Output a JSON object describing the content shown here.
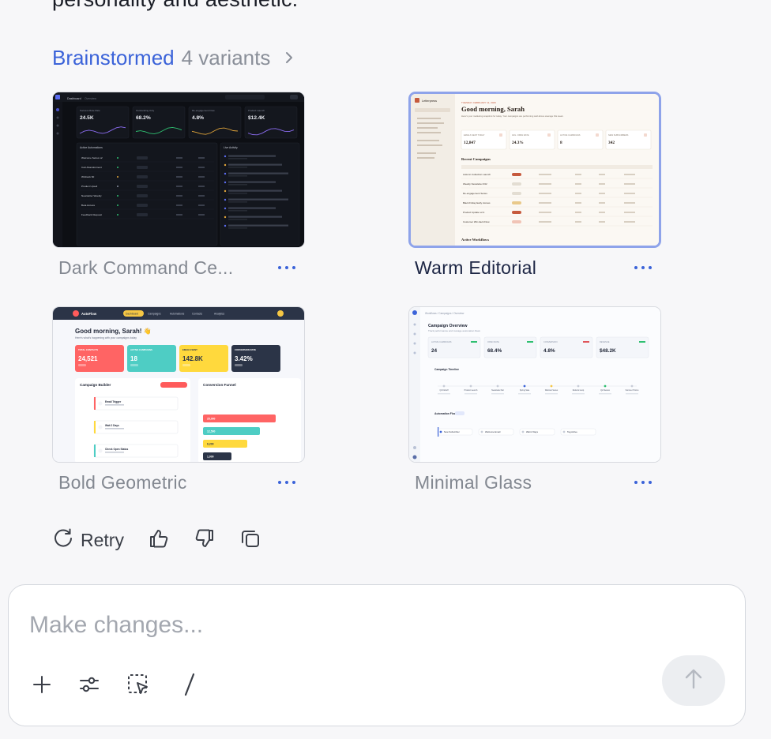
{
  "intro": {
    "text": "personality and aesthetic."
  },
  "brainstorm": {
    "label": "Brainstormed",
    "count": "4 variants",
    "chevron_icon": "chevron-right-icon"
  },
  "variants": [
    {
      "title": "Dark Command Ce...",
      "selected": false,
      "preview": {
        "nav_title": "Dashboard",
        "nav_tab": "Overview",
        "search": "Search",
        "stats": [
          {
            "label": "Success Rate Rate",
            "value": "24.5K"
          },
          {
            "label": "Outstanding Only",
            "value": "68.2%"
          },
          {
            "label": "Re-engagement Flow",
            "value": "4.8%"
          },
          {
            "label": "Product Launch",
            "value": "$12.4K"
          }
        ],
        "panel_left_title": "Active Automations",
        "panel_right_title": "Live Activity",
        "rows": [
          "Welcome Series v2",
          "Cart Abandonment",
          "Winback 60",
          "Product Upsell",
          "Newsletter Weekly",
          "Beta Access",
          "Feedback Request"
        ]
      }
    },
    {
      "title": "Warm Editorial",
      "selected": true,
      "preview": {
        "brand": "Letterpress",
        "date": "TUESDAY, FEBRUARY 11, 2026",
        "greeting": "Good morning, Sarah",
        "sub": "Here's your marketing snapshot for today. Your campaigns are performing well above average this week.",
        "stats": [
          {
            "label": "EMAILS SENT TODAY",
            "value": "12,847"
          },
          {
            "label": "AVG. OPEN RATE",
            "value": "24.3%"
          },
          {
            "label": "ACTIVE CAMPAIGNS",
            "value": "8"
          },
          {
            "label": "NEW SUBSCRIBERS",
            "value": "342"
          }
        ],
        "section": "Recent Campaigns",
        "rows": [
          "Autumn Collection Launch",
          "Weekly Newsletter #42",
          "Re-engagement Series",
          "Black Friday Early Access",
          "Product Update v2.4",
          "Customer Win-back Flow"
        ],
        "section2": "Active Workflows"
      }
    },
    {
      "title": "Bold Geometric",
      "selected": false,
      "preview": {
        "brand": "AutoFlow",
        "nav": [
          "Dashboard",
          "Campaigns",
          "Automations",
          "Contacts",
          "Analytics"
        ],
        "greeting": "Good morning, Sarah! 👋",
        "sub": "Here's what's happening with your campaigns today",
        "stats": [
          {
            "label": "TOTAL CONTACTS",
            "value": "24,521"
          },
          {
            "label": "ACTIVE CAMPAIGNS",
            "value": "18"
          },
          {
            "label": "EMAILS SENT",
            "value": "142.8K"
          },
          {
            "label": "CONVERSION RATE",
            "value": "3.42%"
          }
        ],
        "builder_title": "Campaign Builder",
        "builder_steps": [
          "Email Trigger",
          "Wait 2 Days",
          "Check Open Status"
        ],
        "funnel_title": "Conversion Funnel",
        "funnel_values": [
          "25,000",
          "12,500",
          "6,200",
          "1,000"
        ]
      }
    },
    {
      "title": "Minimal Glass",
      "selected": false,
      "preview": {
        "crumbs": "Workflows  /  Campaigns  /  Overview",
        "title": "Campaign Overview",
        "sub": "Track performance and manage automation flows",
        "stats": [
          {
            "label": "ACTIVE CAMPAIGNS",
            "value": "24"
          },
          {
            "label": "OPEN RATE",
            "value": "68.4%"
          },
          {
            "label": "CONVERSION",
            "value": "4.8%"
          },
          {
            "label": "REVENUE",
            "value": "$48.2K"
          }
        ],
        "timeline_title": "Campaign Timeline",
        "timeline_items": [
          "Q4 Kickoff",
          "Product Launch",
          "Newsletter Rel",
          "Spring Sale",
          "Webinar Series",
          "Referral Loop",
          "Q2 Review",
          "Summer Promo"
        ],
        "flow_title": "Automation Flow",
        "flow_steps": [
          "New Subscriber",
          "Welcome Email",
          "Wait 2 Days",
          "Tag Active"
        ]
      }
    }
  ],
  "actions": {
    "retry": "Retry"
  },
  "composer": {
    "placeholder": "Make changes..."
  },
  "colors": {
    "accent": "#3b63d9",
    "selected_border": "#8ea3ea"
  }
}
